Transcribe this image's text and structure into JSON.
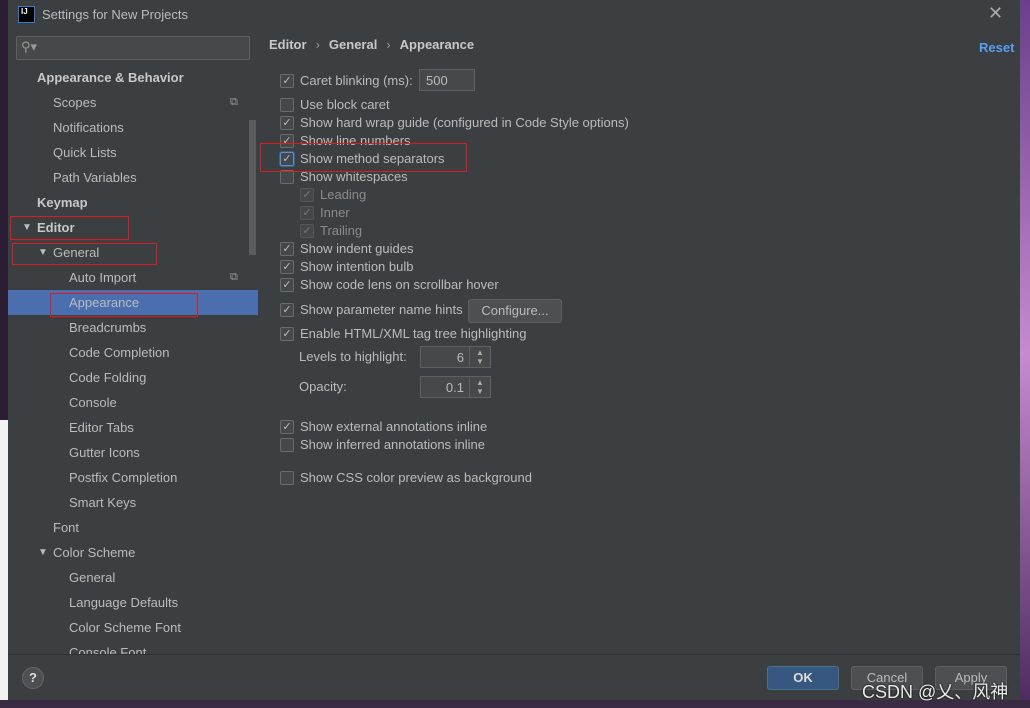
{
  "window": {
    "title": "Settings for New Projects",
    "app_icon_text": "IJ",
    "close_icon": "close-icon"
  },
  "search": {
    "placeholder": ""
  },
  "sidebar": {
    "items": [
      {
        "label": "Appearance & Behavior",
        "level": 0,
        "bold": true
      },
      {
        "label": "Scopes",
        "level": 1,
        "copy": true
      },
      {
        "label": "Notifications",
        "level": 1
      },
      {
        "label": "Quick Lists",
        "level": 1
      },
      {
        "label": "Path Variables",
        "level": 1
      },
      {
        "label": "Keymap",
        "level": 0,
        "bold": true
      },
      {
        "label": "Editor",
        "level": 0,
        "bold": true,
        "expanded": true
      },
      {
        "label": "General",
        "level": 1,
        "expanded": true
      },
      {
        "label": "Auto Import",
        "level": 2,
        "copy": true
      },
      {
        "label": "Appearance",
        "level": 2,
        "selected": true
      },
      {
        "label": "Breadcrumbs",
        "level": 2
      },
      {
        "label": "Code Completion",
        "level": 2
      },
      {
        "label": "Code Folding",
        "level": 2
      },
      {
        "label": "Console",
        "level": 2
      },
      {
        "label": "Editor Tabs",
        "level": 2
      },
      {
        "label": "Gutter Icons",
        "level": 2
      },
      {
        "label": "Postfix Completion",
        "level": 2
      },
      {
        "label": "Smart Keys",
        "level": 2
      },
      {
        "label": "Font",
        "level": 1
      },
      {
        "label": "Color Scheme",
        "level": 1,
        "expanded": true
      },
      {
        "label": "General",
        "level": 2
      },
      {
        "label": "Language Defaults",
        "level": 2
      },
      {
        "label": "Color Scheme Font",
        "level": 2
      },
      {
        "label": "Console Font",
        "level": 2
      }
    ]
  },
  "breadcrumb": [
    "Editor",
    "General",
    "Appearance"
  ],
  "reset_label": "Reset",
  "options": [
    {
      "label": "Caret blinking (ms):",
      "checked": true
    },
    {
      "label": "Use block caret",
      "checked": false
    },
    {
      "label": "Show hard wrap guide (configured in Code Style options)",
      "checked": true
    },
    {
      "label": "Show line numbers",
      "checked": true
    },
    {
      "label": "Show method separators",
      "checked": true
    },
    {
      "label": "Show whitespaces",
      "checked": false
    },
    {
      "label": "Leading",
      "checked": true,
      "disabled": true
    },
    {
      "label": "Inner",
      "checked": true,
      "disabled": true
    },
    {
      "label": "Trailing",
      "checked": true,
      "disabled": true
    },
    {
      "label": "Show indent guides",
      "checked": true
    },
    {
      "label": "Show intention bulb",
      "checked": true
    },
    {
      "label": "Show code lens on scrollbar hover",
      "checked": true
    },
    {
      "label": "Show parameter name hints",
      "checked": true
    },
    {
      "label": "Enable HTML/XML tag tree highlighting",
      "checked": true
    },
    {
      "label": "Show external annotations inline",
      "checked": true
    },
    {
      "label": "Show inferred annotations inline",
      "checked": false
    },
    {
      "label": "Show CSS color preview as background",
      "checked": false
    }
  ],
  "caret_blinking_value": "500",
  "configure_label": "Configure...",
  "levels": {
    "label": "Levels to highlight:",
    "value": "6"
  },
  "opacity": {
    "label": "Opacity:",
    "value": "0.1"
  },
  "footer": {
    "help": "?",
    "ok": "OK",
    "cancel": "Cancel",
    "apply": "Apply"
  },
  "watermark": "CSDN @乂、风神",
  "colors": {
    "selection": "#4b6eaf",
    "highlight_box": "#e0191c",
    "link": "#589df6"
  }
}
